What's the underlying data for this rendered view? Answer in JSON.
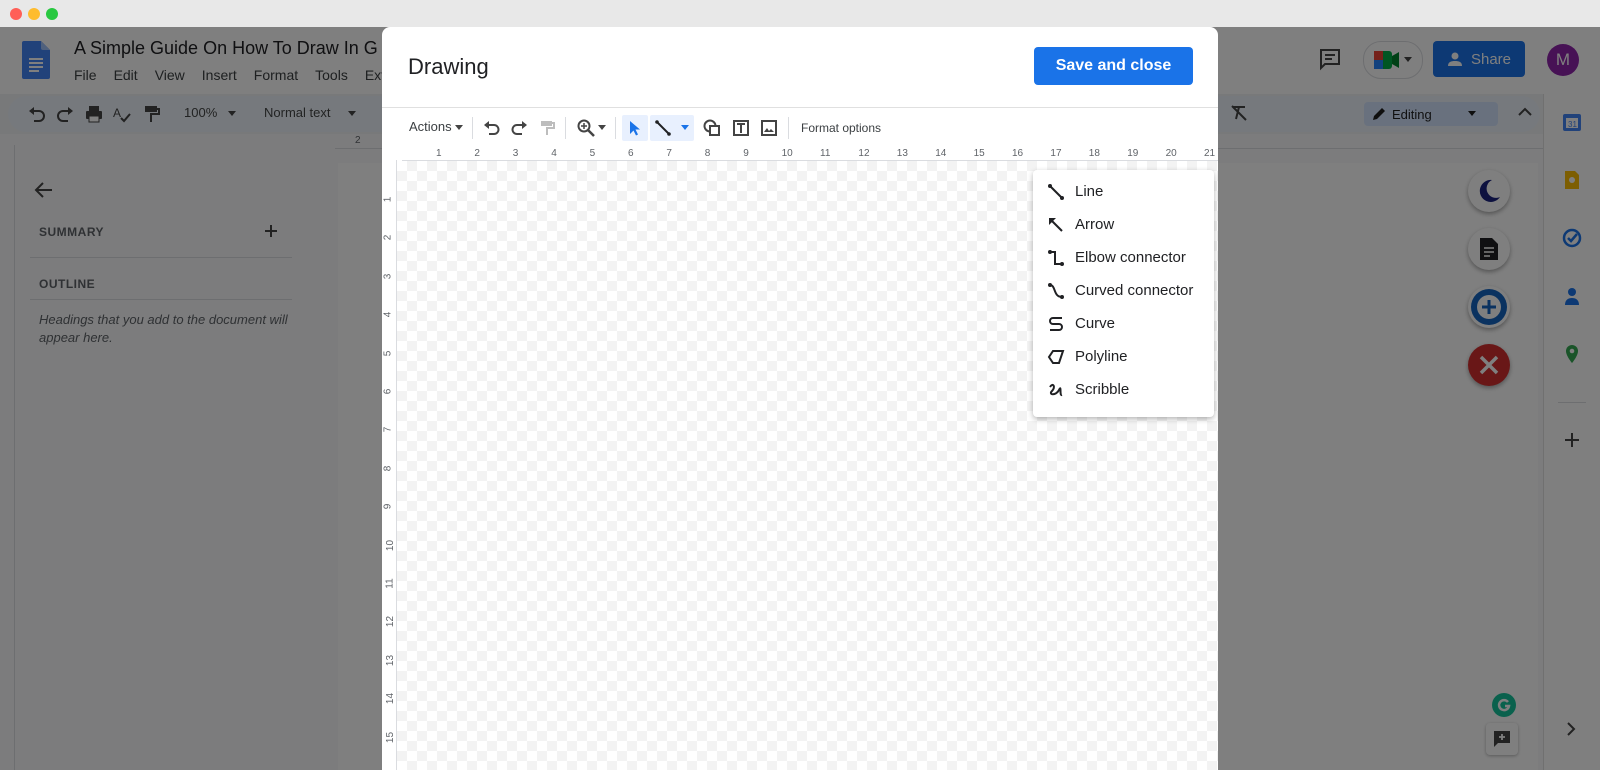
{
  "doc": {
    "title": "A Simple Guide On How To Draw In G",
    "menu": [
      "File",
      "Edit",
      "View",
      "Insert",
      "Format",
      "Tools",
      "Ext"
    ],
    "share_label": "Share",
    "avatar_initial": "M",
    "toolbar": {
      "zoom": "100%",
      "style": "Normal text",
      "editing": "Editing"
    },
    "outline": {
      "summary": "SUMMARY",
      "outline": "OUTLINE",
      "note": "Headings that you add to the document will appear here."
    },
    "top_ruler_mark": "2"
  },
  "dialog": {
    "title": "Drawing",
    "save_close": "Save and close",
    "actions": "Actions",
    "format_options": "Format options",
    "ruler_h": [
      "1",
      "2",
      "3",
      "4",
      "5",
      "6",
      "7",
      "8",
      "9",
      "10",
      "11",
      "12",
      "13",
      "14",
      "15",
      "16",
      "17",
      "18",
      "19",
      "20",
      "21"
    ],
    "ruler_v": [
      "1",
      "2",
      "3",
      "4",
      "5",
      "6",
      "7",
      "8",
      "9",
      "10",
      "11",
      "12",
      "13",
      "14",
      "15"
    ]
  },
  "line_menu": {
    "items": [
      {
        "label": "Line",
        "icon": "line-icon"
      },
      {
        "label": "Arrow",
        "icon": "arrow-icon"
      },
      {
        "label": "Elbow connector",
        "icon": "elbow-connector-icon"
      },
      {
        "label": "Curved connector",
        "icon": "curved-connector-icon"
      },
      {
        "label": "Curve",
        "icon": "curve-icon"
      },
      {
        "label": "Polyline",
        "icon": "polyline-icon"
      },
      {
        "label": "Scribble",
        "icon": "scribble-icon"
      }
    ]
  },
  "colors": {
    "accent": "#1a73e8",
    "overlay": "rgba(0,0,0,0.5)",
    "avatar": "#8e24aa"
  }
}
